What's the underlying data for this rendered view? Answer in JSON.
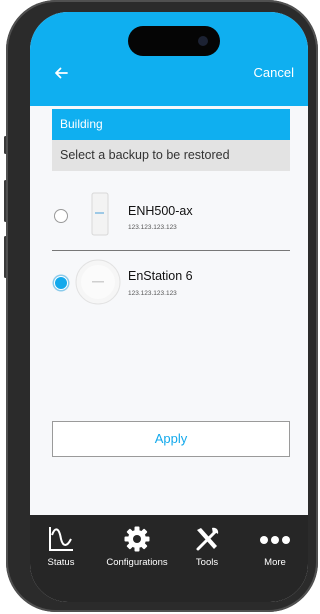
{
  "header": {
    "back_icon": "arrow-left-icon",
    "cancel_label": "Cancel"
  },
  "section": {
    "title": "Building",
    "subtitle": "Select a backup to be restored"
  },
  "devices": [
    {
      "name": "ENH500-ax",
      "ip": "123.123.123.123",
      "selected": false
    },
    {
      "name": "EnStation 6",
      "ip": "123.123.123.123",
      "selected": true
    }
  ],
  "apply_label": "Apply",
  "tabs": [
    {
      "label": "Status",
      "icon": "status-chart-icon"
    },
    {
      "label": "Configurations",
      "icon": "gear-icon"
    },
    {
      "label": "Tools",
      "icon": "tools-icon"
    },
    {
      "label": "More",
      "icon": "more-dots-icon"
    }
  ],
  "colors": {
    "accent": "#0FAFF0",
    "tabbar": "#262626",
    "subbar": "#E3E3E3"
  }
}
